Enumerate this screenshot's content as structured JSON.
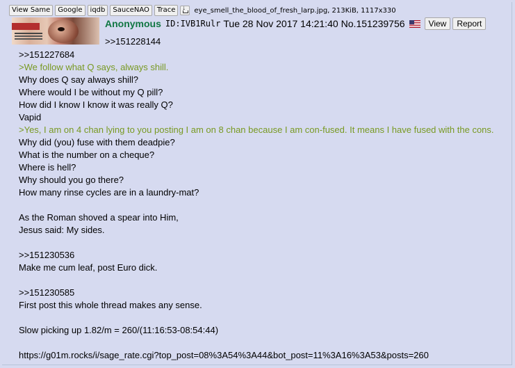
{
  "file": {
    "buttons": [
      "View Same",
      "Google",
      "iqdb",
      "SauceNAO",
      "Trace"
    ],
    "name": "eye_smell_the_blood_of_fresh_larp.jpg, 213KiB, 1117x330"
  },
  "post": {
    "name": "Anonymous",
    "id": "ID:IVB1Rulr",
    "datetime": "Tue 28 Nov 2017 14:21:40",
    "number": "No.151239756",
    "flag_icon": "us-flag-icon",
    "view_label": "View",
    "report_label": "Report",
    "backlink": ">>151228144"
  },
  "body": [
    {
      "text": ">>151227684",
      "type": "plain"
    },
    {
      "text": ">We follow what Q says, always shill.",
      "type": "quote"
    },
    {
      "text": "Why does Q say always shill?",
      "type": "plain"
    },
    {
      "text": "Where would I be without my Q pill?",
      "type": "plain"
    },
    {
      "text": "How did I know I know it was really Q?",
      "type": "plain"
    },
    {
      "text": "Vapid",
      "type": "plain"
    },
    {
      "text": ">Yes, I am on 4 chan lying to you posting I am on 8 chan because I am con-fused. It means I have fused with the cons.",
      "type": "quote"
    },
    {
      "text": "Why did (you) fuse with them deadpie?",
      "type": "plain"
    },
    {
      "text": "What is the number on a cheque?",
      "type": "plain"
    },
    {
      "text": "Where is hell?",
      "type": "plain"
    },
    {
      "text": "Why should you go there?",
      "type": "plain"
    },
    {
      "text": "How many rinse cycles are in a laundry-mat?",
      "type": "plain"
    },
    {
      "text": "",
      "type": "plain"
    },
    {
      "text": "As the Roman shoved a spear into Him,",
      "type": "plain"
    },
    {
      "text": "Jesus said: My sides.",
      "type": "plain"
    },
    {
      "text": "",
      "type": "plain"
    },
    {
      "text": ">>151230536",
      "type": "plain"
    },
    {
      "text": "Make me cum leaf, post Euro dick.",
      "type": "plain"
    },
    {
      "text": "",
      "type": "plain"
    },
    {
      "text": ">>151230585",
      "type": "plain"
    },
    {
      "text": "First post this whole thread makes any sense.",
      "type": "plain"
    },
    {
      "text": "",
      "type": "plain"
    },
    {
      "text": "Slow picking up 1.82/m = 260/(11:16:53-08:54:44)",
      "type": "plain"
    },
    {
      "text": "",
      "type": "plain"
    },
    {
      "text": "https://g01m.rocks/i/sage_rate.cgi?top_post=08%3A54%3A44&bot_post=11%3A16%3A53&posts=260",
      "type": "plain"
    }
  ],
  "colors": {
    "background": "#d6daf0",
    "name": "#117743",
    "quote": "#789922"
  }
}
